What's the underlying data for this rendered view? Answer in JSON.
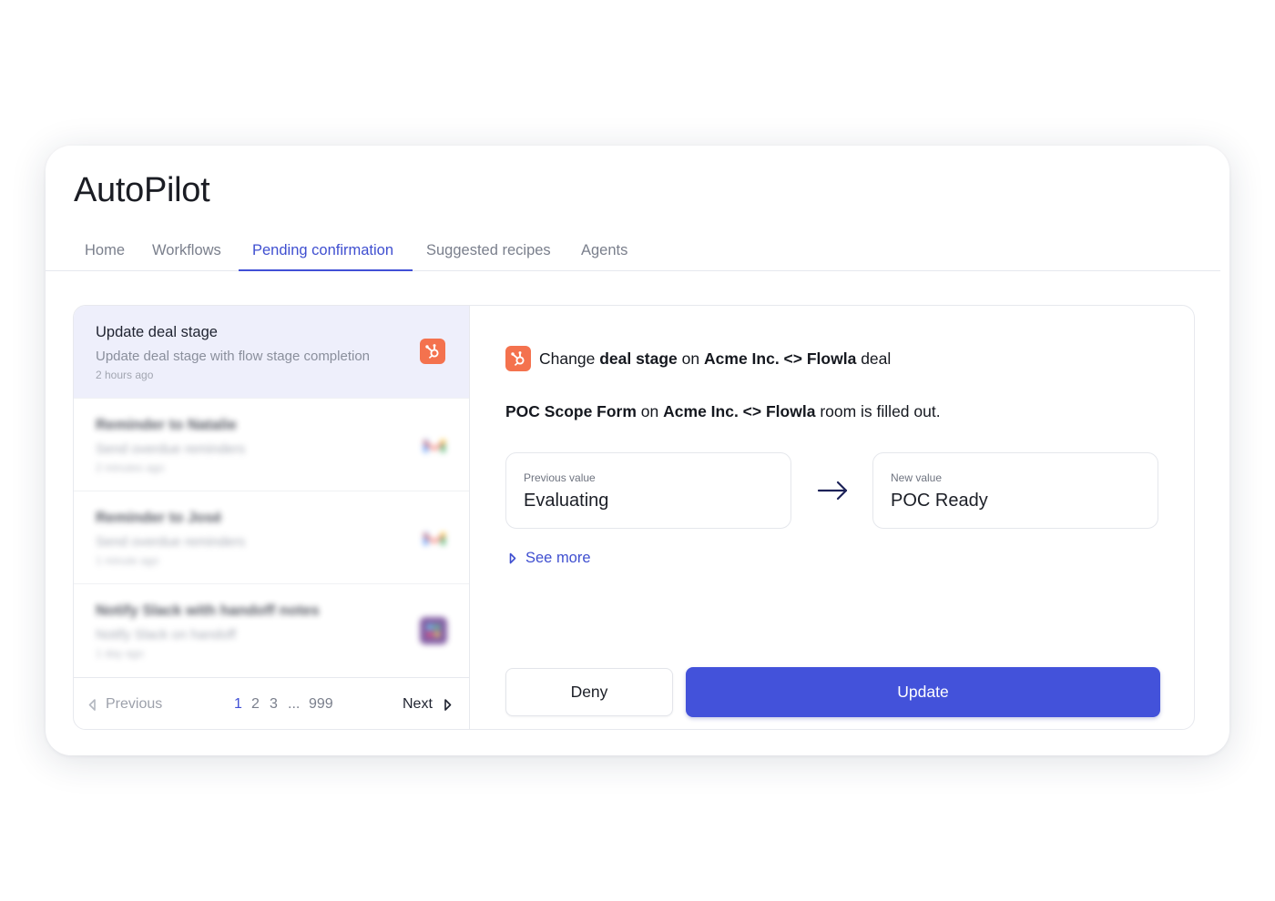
{
  "app": {
    "title": "AutoPilot"
  },
  "tabs": [
    {
      "label": "Home"
    },
    {
      "label": "Workflows"
    },
    {
      "label": "Pending confirmation",
      "active": true
    },
    {
      "label": "Suggested recipes"
    },
    {
      "label": "Agents"
    }
  ],
  "list": {
    "items": [
      {
        "title": "Update deal stage",
        "subtitle": "Update deal stage with flow stage completion",
        "time": "2 hours ago",
        "icon": "hubspot-icon",
        "selected": true
      },
      {
        "title": "Reminder to Natalie",
        "subtitle": "Send overdue reminders",
        "time": "2 minutes ago",
        "icon": "gmail-icon",
        "blurred": true
      },
      {
        "title": "Reminder to José",
        "subtitle": "Send overdue reminders",
        "time": "1 minute ago",
        "icon": "gmail-icon",
        "blurred": true
      },
      {
        "title": "Notify Slack with handoff notes",
        "subtitle": "Notify Slack on handoff",
        "time": "1 day ago",
        "icon": "slack-icon",
        "blurred": true
      }
    ]
  },
  "pagination": {
    "previous": "Previous",
    "pages": [
      "1",
      "2",
      "3",
      "...",
      "999"
    ],
    "current": "1",
    "next": "Next"
  },
  "detail": {
    "change": {
      "prefix": "Change",
      "field": "deal stage",
      "on": "on",
      "target": "Acme Inc. <> Flowla",
      "suffix": "deal"
    },
    "trigger": {
      "form": "POC Scope Form",
      "on": "on",
      "target": "Acme Inc. <> Flowla",
      "suffix": "room is filled out."
    },
    "previous_value": {
      "label": "Previous value",
      "value": "Evaluating"
    },
    "new_value": {
      "label": "New value",
      "value": "POC Ready"
    },
    "see_more": "See more"
  },
  "actions": {
    "deny": "Deny",
    "update": "Update"
  },
  "colors": {
    "accent": "#4352da",
    "hubspot": "#f4724e",
    "selected_row": "#eeeffb"
  }
}
